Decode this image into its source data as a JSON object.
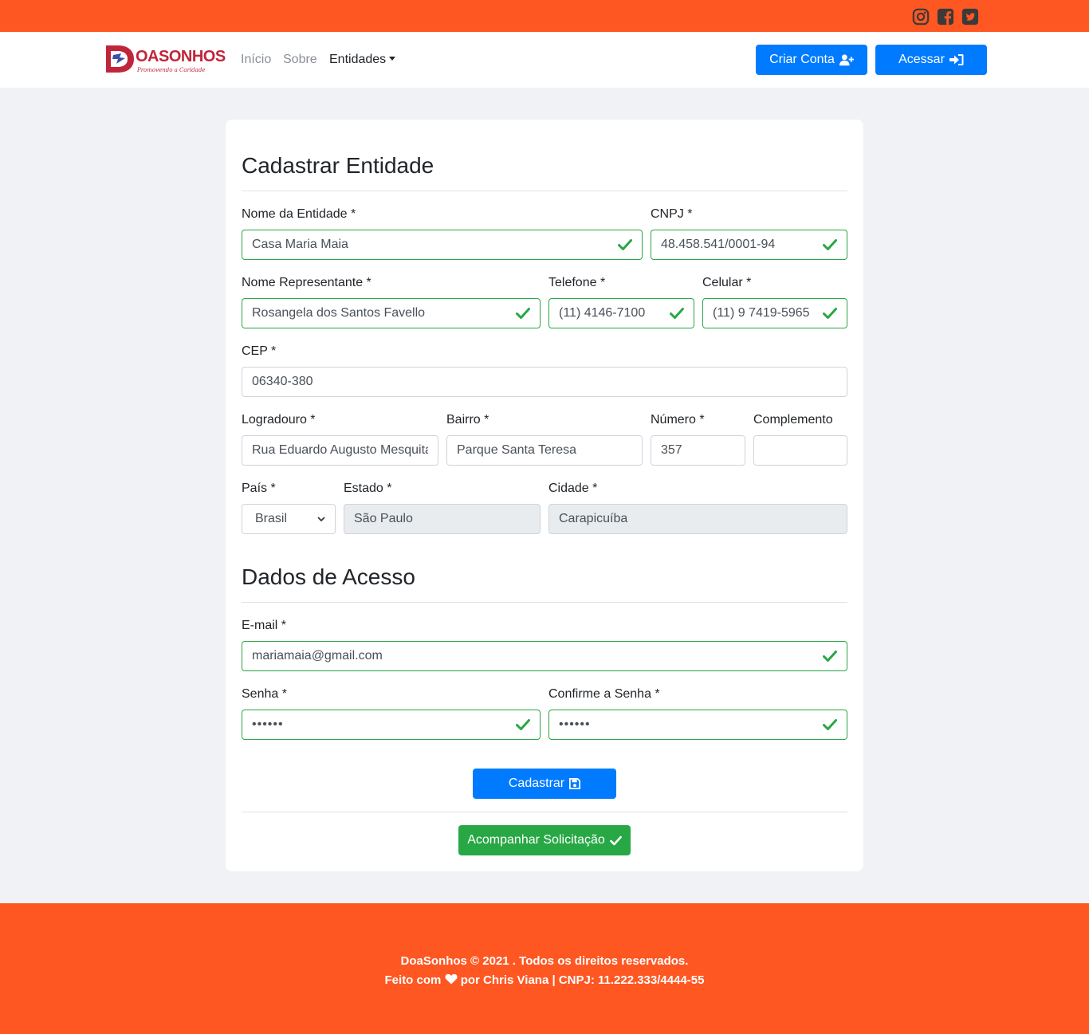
{
  "social": {
    "instagram_icon": "instagram-icon",
    "facebook_icon": "facebook-icon",
    "twitter_icon": "twitter-icon"
  },
  "brand": {
    "name": "OASONHOS",
    "tagline": "Promovendo a Caridade"
  },
  "nav": {
    "inicio": "Início",
    "sobre": "Sobre",
    "entidades": "Entidades"
  },
  "header_buttons": {
    "criar_conta": "Criar Conta",
    "acessar": "Acessar"
  },
  "form": {
    "title": "Cadastrar Entidade",
    "nome_entidade": {
      "label": "Nome da Entidade *",
      "value": "Casa Maria Maia"
    },
    "cnpj": {
      "label": "CNPJ *",
      "value": "48.458.541/0001-94"
    },
    "nome_representante": {
      "label": "Nome Representante *",
      "value": "Rosangela dos Santos Favello"
    },
    "telefone": {
      "label": "Telefone *",
      "value": "(11) 4146-7100"
    },
    "celular": {
      "label": "Celular *",
      "value": "(11) 9 7419-5965"
    },
    "cep": {
      "label": "CEP *",
      "value": "06340-380"
    },
    "logradouro": {
      "label": "Logradouro *",
      "value": "Rua Eduardo Augusto Mesquita"
    },
    "bairro": {
      "label": "Bairro *",
      "value": "Parque Santa Teresa"
    },
    "numero": {
      "label": "Número *",
      "value": "357"
    },
    "complemento": {
      "label": "Complemento",
      "value": ""
    },
    "pais": {
      "label": "País *",
      "value": "Brasil"
    },
    "estado": {
      "label": "Estado *",
      "value": "São Paulo"
    },
    "cidade": {
      "label": "Cidade *",
      "value": "Carapicuíba"
    },
    "access_title": "Dados de Acesso",
    "email": {
      "label": "E-mail *",
      "value": "mariamaia@gmail.com"
    },
    "senha": {
      "label": "Senha *",
      "value": "••••••"
    },
    "confirme_senha": {
      "label": "Confirme a Senha *",
      "value": "••••••"
    },
    "submit_label": "Cadastrar",
    "track_label": "Acompanhar Solicitação"
  },
  "footer": {
    "line1": "DoaSonhos © 2021 . Todos os direitos reservados.",
    "line2_prefix": "Feito com",
    "line2_suffix": "por Chris Viana | CNPJ: 11.222.333/4444-55"
  },
  "colors": {
    "accent": "#ff5722",
    "primary": "#007bff",
    "success": "#28a745",
    "brand": "#c0263a"
  }
}
